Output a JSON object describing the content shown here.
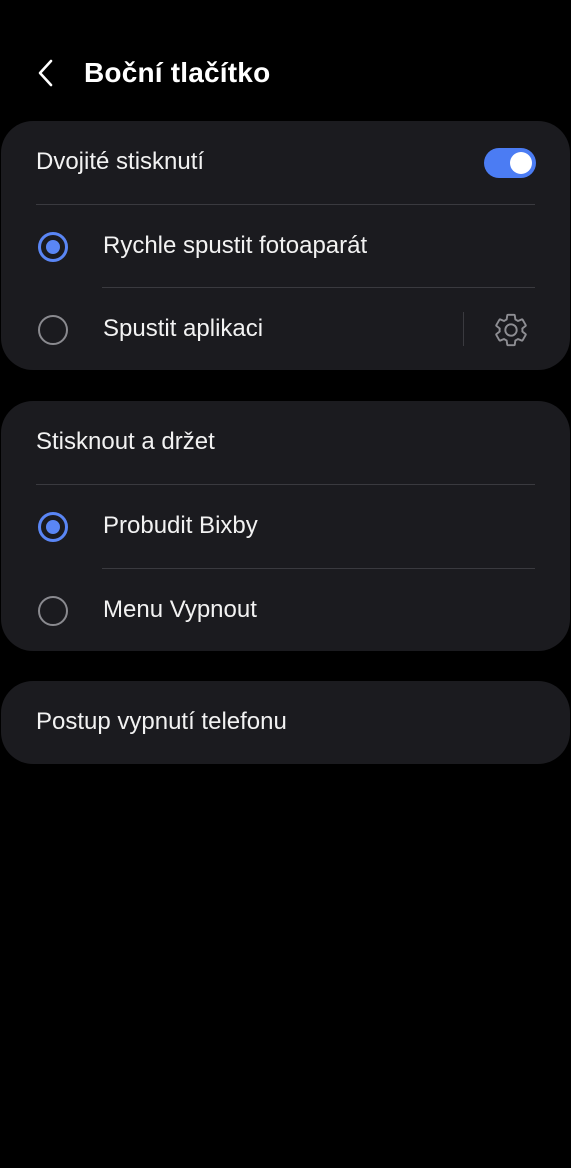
{
  "header": {
    "title": "Boční tlačítko",
    "back_icon": "chevron-left-icon"
  },
  "double_press": {
    "label": "Dvojité stisknutí",
    "toggle_on": true,
    "options": [
      {
        "label": "Rychle spustit fotoaparát",
        "selected": true
      },
      {
        "label": "Spustit aplikaci",
        "selected": false,
        "settings_icon": "gear-icon"
      }
    ]
  },
  "press_and_hold": {
    "label": "Stisknout a držet",
    "options": [
      {
        "label": "Probudit Bixby",
        "selected": true
      },
      {
        "label": "Menu Vypnout",
        "selected": false
      }
    ]
  },
  "power_off_procedure": {
    "label": "Postup vypnutí telefonu"
  },
  "colors": {
    "background": "#000000",
    "card": "#1b1b1f",
    "accent": "#4b7cf3",
    "divider": "#3a3a3f"
  }
}
